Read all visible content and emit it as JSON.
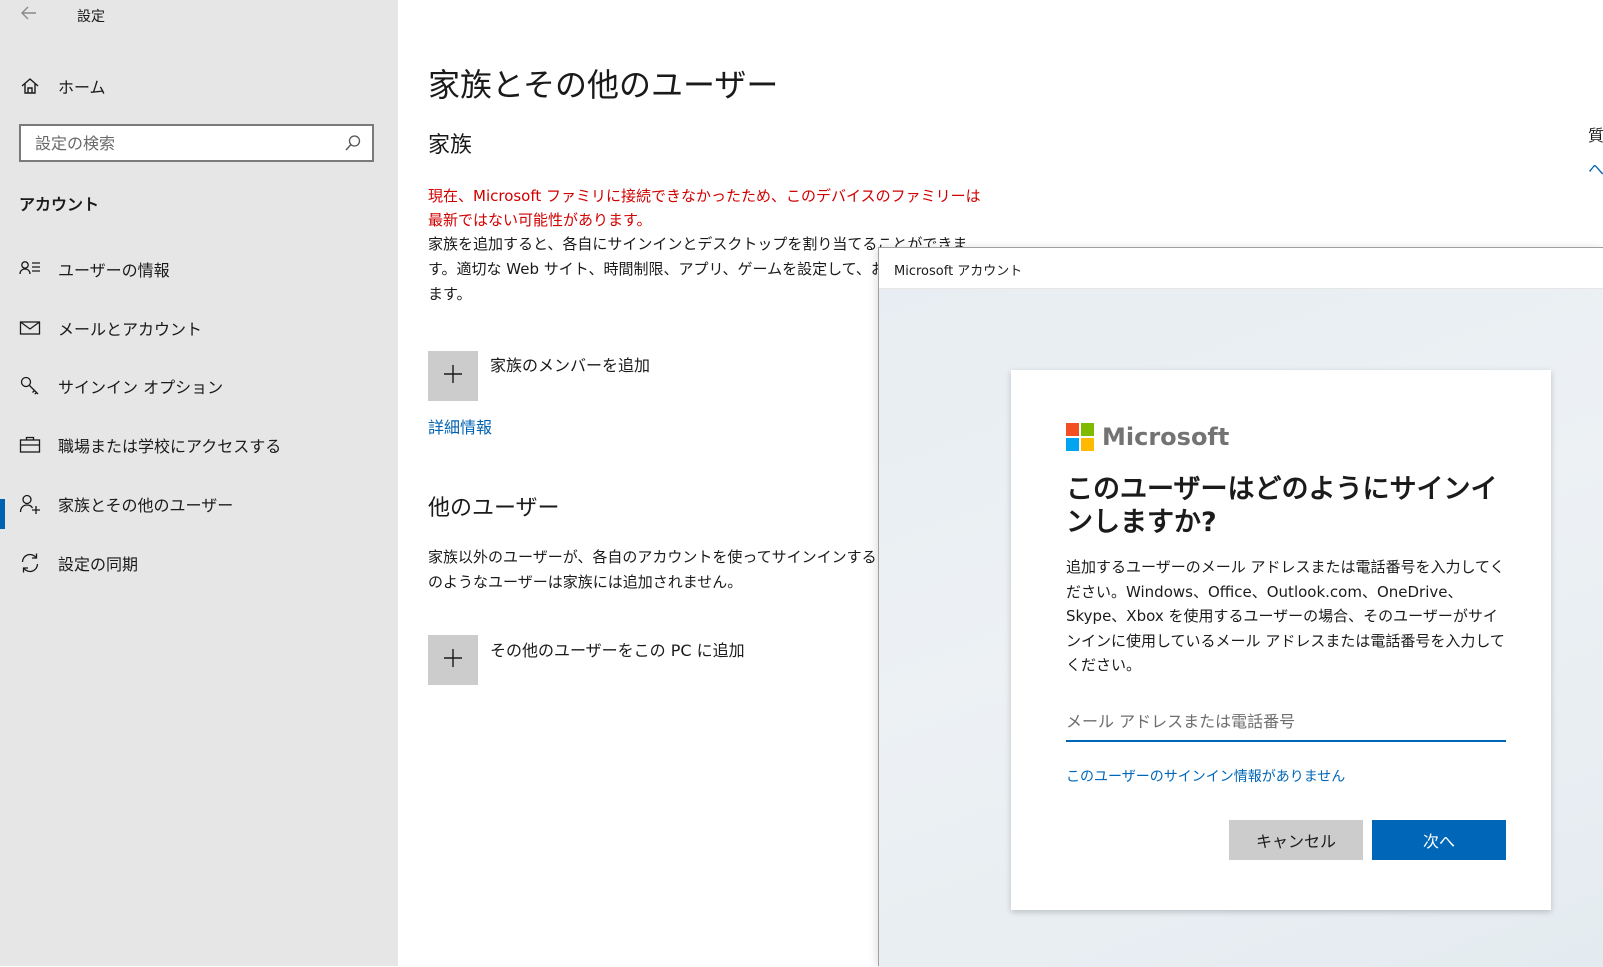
{
  "app": {
    "title": "設定"
  },
  "sidebar": {
    "home_label": "ホーム",
    "search": {
      "placeholder": "設定の検索",
      "value": ""
    },
    "section_label": "アカウント",
    "items": [
      {
        "label": "ユーザーの情報",
        "icon": "person-list-icon"
      },
      {
        "label": "メールとアカウント",
        "icon": "mail-icon"
      },
      {
        "label": "サインイン オプション",
        "icon": "key-icon"
      },
      {
        "label": "職場または学校にアクセスする",
        "icon": "briefcase-icon"
      },
      {
        "label": "家族とその他のユーザー",
        "icon": "person-add-icon",
        "active": true
      },
      {
        "label": "設定の同期",
        "icon": "sync-icon"
      }
    ]
  },
  "main": {
    "page_title": "家族とその他のユーザー",
    "family": {
      "heading": "家族",
      "warning": "現在、Microsoft ファミリに接続できなかったため、このデバイスのファミリーは最新ではない可能性があります。",
      "description": "家族を追加すると、各自にサインインとデスクトップを割り当てることができます。適切な Web サイト、時間制限、アプリ、ゲームを設定して、お子様の",
      "description_tail": "ます。",
      "add_label": "家族のメンバーを追加",
      "more_info_link": "詳細情報"
    },
    "other_users": {
      "heading": "他のユーザー",
      "description": "家族以外のユーザーが、各自のアカウントを使ってサインインすること",
      "description_line2": "のようなユーザーは家族には追加されません。",
      "add_label": "その他のユーザーをこの PC に追加"
    },
    "right_edge": {
      "text1": "質",
      "link1": "ヘ"
    }
  },
  "dialog": {
    "window_title": "Microsoft アカウント",
    "brand": "Microsoft",
    "brand_colors": [
      "#f25022",
      "#7fba00",
      "#00a4ef",
      "#ffb900"
    ],
    "heading": "このユーザーはどのようにサインインしますか?",
    "description": "追加するユーザーのメール アドレスまたは電話番号を入力してください。Windows、Office、Outlook.com、OneDrive、Skype、Xbox を使用するユーザーの場合、そのユーザーがサインインに使用しているメール アドレスまたは電話番号を入力してください。",
    "email": {
      "placeholder": "メール アドレスまたは電話番号",
      "value": ""
    },
    "no_info_link": "このユーザーのサインイン情報がありません",
    "cancel_label": "キャンセル",
    "next_label": "次へ"
  }
}
